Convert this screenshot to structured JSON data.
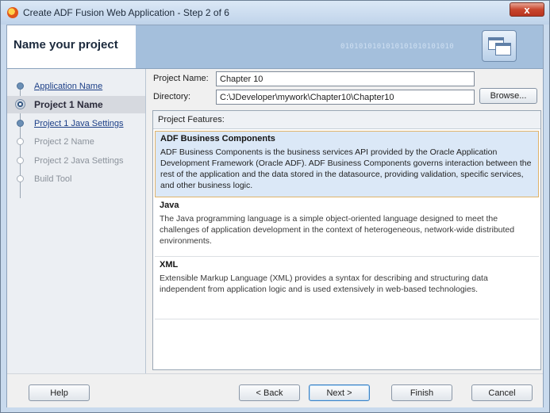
{
  "window": {
    "title": "Create ADF Fusion Web Application - Step 2 of 6",
    "close_glyph": "x"
  },
  "banner": {
    "title": "Name your project",
    "decoration_text": "0101010101010101010101010",
    "icon": "wizard-windows-icon"
  },
  "steps": [
    {
      "label": "Application Name",
      "state": "done"
    },
    {
      "label": "Project 1 Name",
      "state": "current"
    },
    {
      "label": "Project 1 Java Settings",
      "state": "done"
    },
    {
      "label": "Project 2 Name",
      "state": "pending"
    },
    {
      "label": "Project 2 Java Settings",
      "state": "pending"
    },
    {
      "label": "Build Tool",
      "state": "pending"
    }
  ],
  "form": {
    "project_name_label": "Project Name:",
    "project_name_value": "Chapter 10",
    "directory_label": "Directory:",
    "directory_value": "C:\\JDeveloper\\mywork\\Chapter10\\Chapter10",
    "browse_label": "Browse..."
  },
  "features": {
    "header": "Project Features:",
    "items": [
      {
        "name": "ADF Business Components",
        "description": "ADF Business Components is the business services API provided by the Oracle Application Development Framework (Oracle ADF). ADF Business Components governs interaction between the rest of the application and the data stored in the datasource, providing validation, specific services, and other business logic.",
        "selected": true
      },
      {
        "name": "Java",
        "description": "The Java programming language is a simple object-oriented language designed to meet the challenges of application development in the context of heterogeneous, network-wide distributed environments.",
        "selected": false
      },
      {
        "name": "XML",
        "description": "Extensible Markup Language (XML) provides a syntax for describing and structuring data independent from application logic and is used extensively in web-based technologies.",
        "selected": false
      }
    ]
  },
  "buttons": {
    "help": "Help",
    "back": "< Back",
    "next": "Next >",
    "finish": "Finish",
    "cancel": "Cancel"
  },
  "colors": {
    "accent": "#3d82c4",
    "selection_bg": "#dbe8f7",
    "selection_border": "#e0b36a",
    "link": "#1c3f87"
  }
}
